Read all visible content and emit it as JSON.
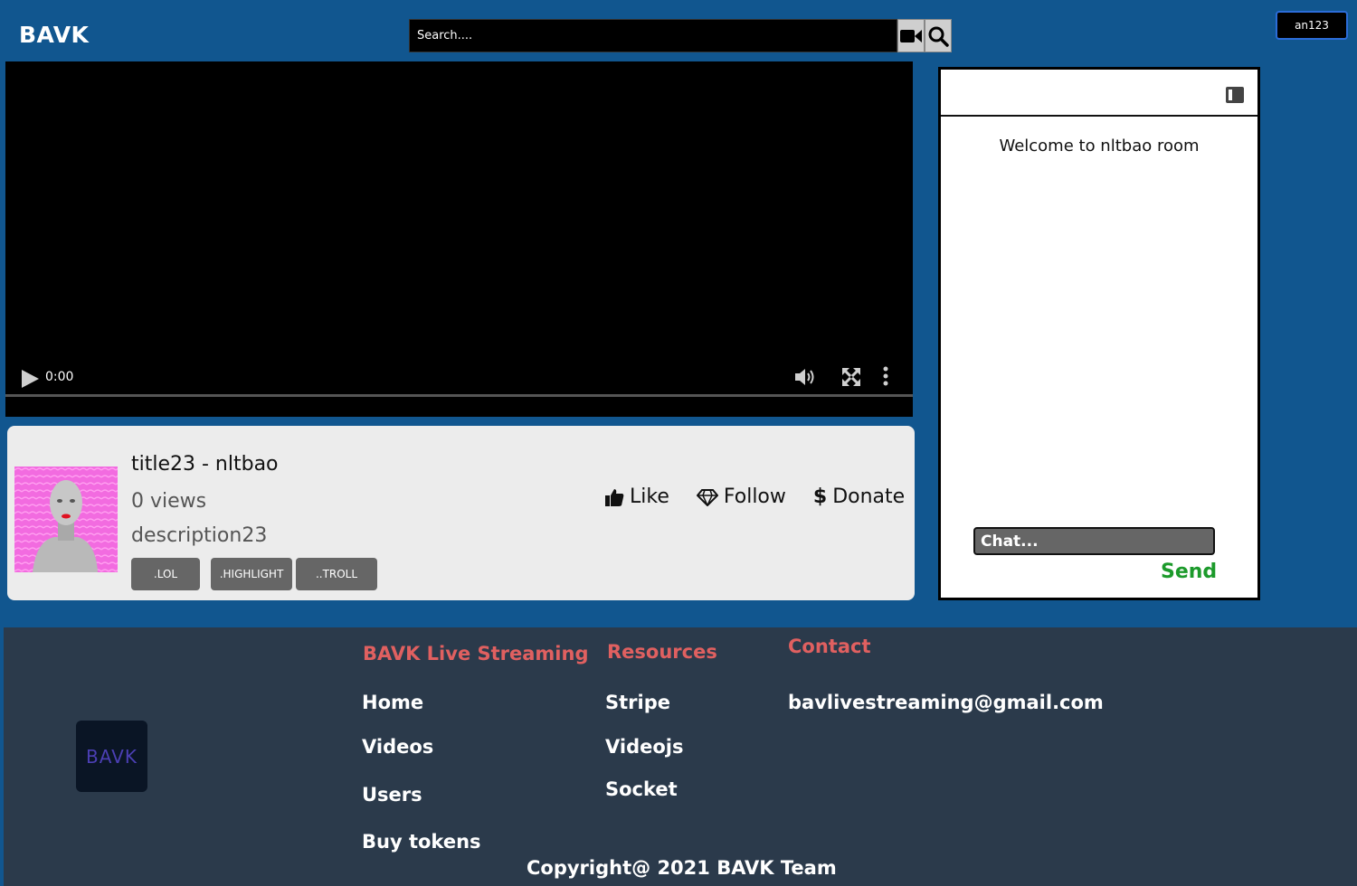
{
  "header": {
    "logo": "BAVK",
    "search_placeholder": "Search....",
    "user_label": "an123"
  },
  "video": {
    "time": "0:00"
  },
  "info": {
    "title": "title23 - nltbao",
    "views": "0 views",
    "description": "description23",
    "tags": [
      ".LOL",
      ".HIGHLIGHT",
      "..TROLL"
    ],
    "actions": {
      "like": "Like",
      "follow": "Follow",
      "donate": "Donate"
    }
  },
  "chat": {
    "welcome": "Welcome to nltbao room",
    "placeholder": "Chat...",
    "send": "Send"
  },
  "footer": {
    "logo": "BAVK",
    "col1": {
      "heading": "BAVK Live Streaming",
      "links": [
        "Home",
        "Videos",
        "Users",
        "Buy tokens"
      ]
    },
    "col2": {
      "heading": "Resources",
      "links": [
        "Stripe",
        "Videojs",
        "Socket"
      ]
    },
    "col3": {
      "heading": "Contact",
      "email": "bavlivestreaming@gmail.com"
    },
    "copyright": "Copyright@ 2021 BAVK Team"
  },
  "colors": {
    "background": "#11568f",
    "footer": "#2b3a4b",
    "footer_heading": "#e06060",
    "send": "#1c9a2b"
  },
  "icons": [
    "video-camera-icon",
    "search-icon",
    "play-icon",
    "volume-icon",
    "fullscreen-icon",
    "more-vertical-icon",
    "thumbs-up-icon",
    "diamond-icon",
    "dollar-icon",
    "panel-toggle-icon"
  ]
}
